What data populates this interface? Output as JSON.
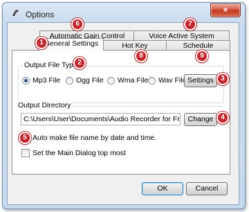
{
  "window": {
    "title": "Options",
    "close_glyph": "×",
    "app_icon": "app-icon"
  },
  "tabs": {
    "row_back": [
      {
        "label": "Automatic Gain Control"
      },
      {
        "label": "Voice Active System"
      }
    ],
    "row_front": [
      {
        "label": "General Settings",
        "active": true
      },
      {
        "label": "Hot Key"
      },
      {
        "label": "Schedule"
      }
    ]
  },
  "output_file_type": {
    "title": "Output File Type",
    "options": [
      {
        "label": "Mp3 File",
        "selected": true
      },
      {
        "label": "Ogg File",
        "selected": false
      },
      {
        "label": "Wma File",
        "selected": false
      },
      {
        "label": "Wav File",
        "selected": false
      }
    ],
    "settings_button": "Settings"
  },
  "output_directory": {
    "title": "Output Directory",
    "path": "C:\\Users\\User\\Documents\\Audio Recorder for Free\\",
    "change_button": "Change"
  },
  "checkboxes": [
    {
      "label": "Auto make file name by date and time.",
      "checked": true
    },
    {
      "label": "Set the Main Dialog top most",
      "checked": false
    }
  ],
  "buttons": {
    "ok": "OK",
    "cancel": "Cancel"
  },
  "callouts": [
    "1",
    "2",
    "3",
    "4",
    "5",
    "6",
    "7",
    "8",
    "9"
  ],
  "colors": {
    "callout": "#c4262e",
    "close": "#c2361e"
  }
}
